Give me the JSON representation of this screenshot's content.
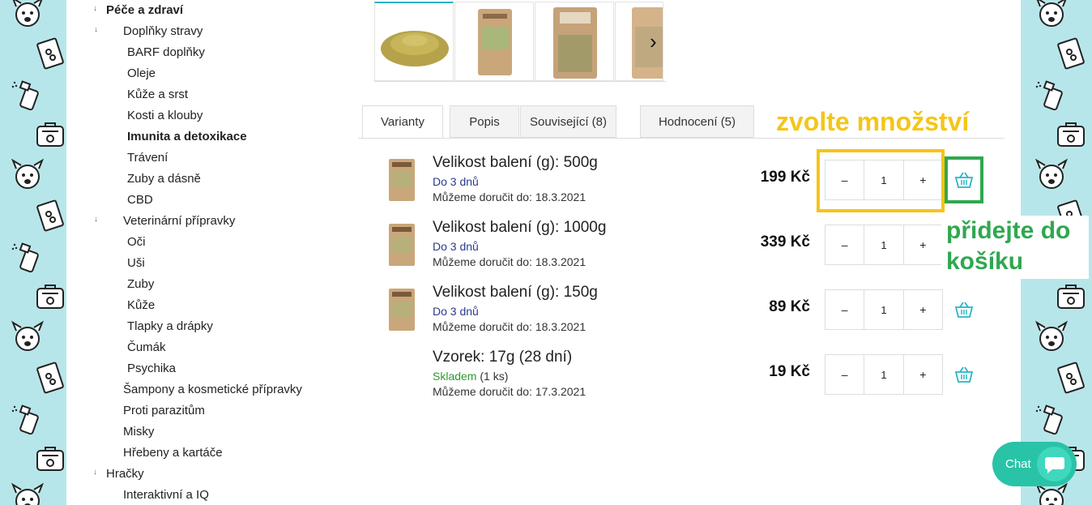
{
  "sidebar": {
    "items": [
      {
        "label": "Péče a zdraví",
        "bold": true
      },
      {
        "label": "Doplňky stravy"
      },
      {
        "label": "BARF doplňky"
      },
      {
        "label": "Oleje"
      },
      {
        "label": "Kůže a srst"
      },
      {
        "label": "Kosti a klouby"
      },
      {
        "label": "Imunita a detoxikace",
        "bold": true
      },
      {
        "label": "Trávení"
      },
      {
        "label": "Zuby a dásně"
      },
      {
        "label": "CBD"
      },
      {
        "label": "Veterinární přípravky"
      },
      {
        "label": "Oči"
      },
      {
        "label": "Uši"
      },
      {
        "label": "Zuby"
      },
      {
        "label": "Kůže"
      },
      {
        "label": "Tlapky a drápky"
      },
      {
        "label": "Čumák"
      },
      {
        "label": "Psychika"
      },
      {
        "label": "Šampony a kosmetické přípravky"
      },
      {
        "label": "Proti parazitům"
      },
      {
        "label": "Misky"
      },
      {
        "label": "Hřebeny a kartáče"
      },
      {
        "label": "Hračky"
      },
      {
        "label": "Interaktivní a IQ"
      }
    ],
    "arrow_glyph": "↓"
  },
  "gallery": {
    "next_glyph": "›",
    "thumb_count": 4
  },
  "tabs": [
    {
      "label": "Varianty",
      "active": true
    },
    {
      "label": "Popis"
    },
    {
      "label": "Související (8)"
    },
    {
      "label": "Hodnocení (5)"
    }
  ],
  "variants": [
    {
      "title": "Velikost balení (g): 500g",
      "availability": "Do 3 dnů",
      "availability_qty": "",
      "delivery": "Můžeme doručit do: 18.3.2021",
      "price": "199 Kč",
      "qty": "1",
      "has_image": true
    },
    {
      "title": "Velikost balení (g): 1000g",
      "availability": "Do 3 dnů",
      "availability_qty": "",
      "delivery": "Můžeme doručit do: 18.3.2021",
      "price": "339 Kč",
      "qty": "1",
      "has_image": true
    },
    {
      "title": "Velikost balení (g): 150g",
      "availability": "Do 3 dnů",
      "availability_qty": "",
      "delivery": "Můžeme doručit do: 18.3.2021",
      "price": "89 Kč",
      "qty": "1",
      "has_image": true
    },
    {
      "title": "Vzorek: 17g (28 dní)",
      "availability": "Skladem",
      "availability_qty": "(1 ks)",
      "delivery": "Můžeme doručit do: 17.3.2021",
      "price": "19 Kč",
      "qty": "1",
      "has_image": false
    }
  ],
  "qty_controls": {
    "minus": "–",
    "plus": "+"
  },
  "annotations": {
    "choose_quantity": "zvolte množství",
    "add_to_cart_line1": "přidejte do",
    "add_to_cart_line2": "košíku"
  },
  "chat": {
    "label": "Chat"
  },
  "colors": {
    "pattern_bg": "#b7e6ea",
    "accent": "#29b6c5",
    "annotation_yellow": "#f5c518",
    "annotation_green": "#2fa84f",
    "chat": "#29c3a8",
    "availability_blue": "#2a3a8f",
    "in_stock_green": "#2e9a2e"
  },
  "icons": {
    "cart": "basket-icon",
    "pattern": [
      "dog-face-icon",
      "treat-bag-icon",
      "spray-bottle-icon",
      "pet-carrier-icon"
    ]
  }
}
